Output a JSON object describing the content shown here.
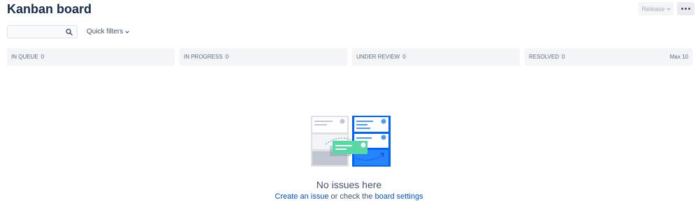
{
  "header": {
    "title": "Kanban board",
    "release_label": "Release",
    "more_icon": "more-horizontal-icon"
  },
  "toolbar": {
    "search_value": "",
    "search_icon": "search-icon",
    "quick_filters_label": "Quick filters"
  },
  "columns": [
    {
      "name": "IN QUEUE",
      "count": "0",
      "max": ""
    },
    {
      "name": "IN PROGRESS",
      "count": "0",
      "max": ""
    },
    {
      "name": "UNDER REVIEW",
      "count": "0",
      "max": ""
    },
    {
      "name": "RESOLVED",
      "count": "0",
      "max": "Max 10"
    }
  ],
  "empty_state": {
    "title": "No issues here",
    "create_link": "Create an issue",
    "middle_text": " or check the ",
    "settings_link": "board settings"
  },
  "colors": {
    "accent": "#0065ff",
    "link": "#0052cc",
    "card_green": "#57d9a3",
    "column_bg": "#f4f5f7"
  }
}
